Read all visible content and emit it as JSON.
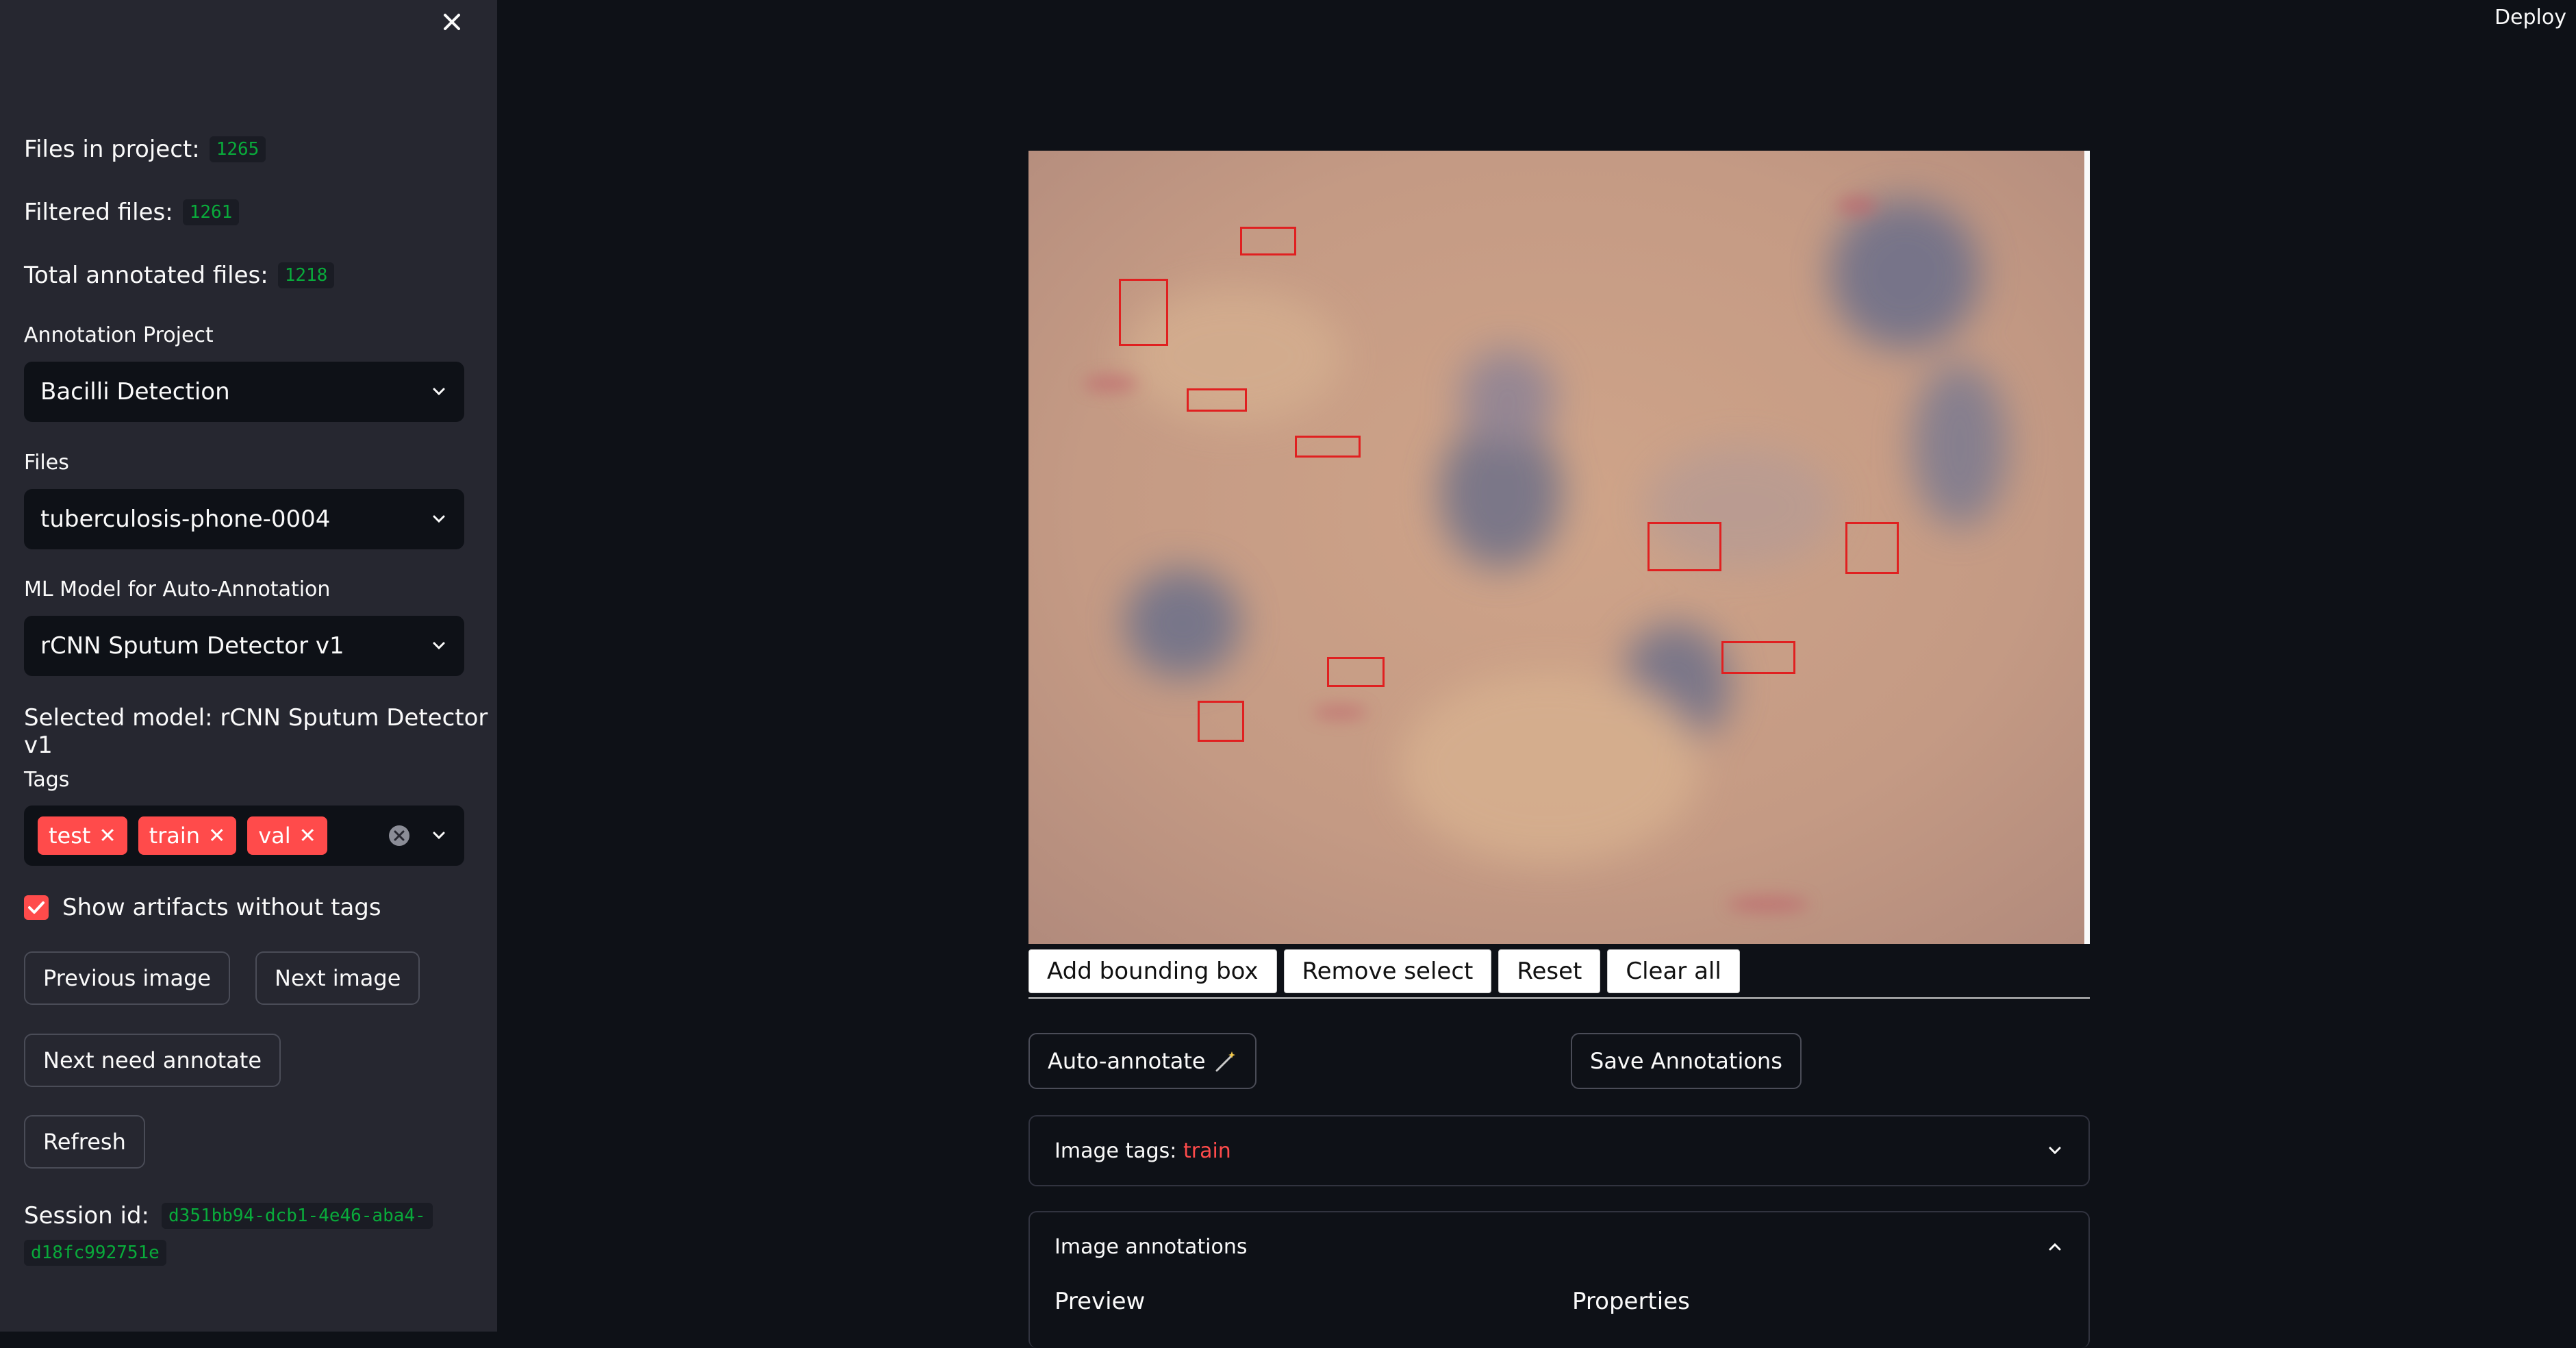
{
  "sidebar": {
    "files_in_project_label": "Files in project:",
    "files_in_project_value": "1265",
    "filtered_files_label": "Filtered files:",
    "filtered_files_value": "1261",
    "total_annotated_label": "Total annotated files:",
    "total_annotated_value": "1218",
    "project_label": "Annotation Project",
    "project_value": "Bacilli Detection",
    "files_label": "Files",
    "files_value": "tuberculosis-phone-0004",
    "model_label": "ML Model for Auto-Annotation",
    "model_value": "rCNN Sputum Detector v1",
    "selected_model_text": "Selected model: rCNN Sputum Detector v1",
    "tags_label": "Tags",
    "tags": [
      "test",
      "train",
      "val"
    ],
    "show_artifacts_label": "Show artifacts without tags",
    "show_artifacts_checked": true,
    "previous_button": "Previous image",
    "next_button": "Next image",
    "next_need_button": "Next need annotate",
    "refresh_button": "Refresh",
    "session_label": "Session id:",
    "session_part1": "d351bb94-dcb1-4e46-aba4-",
    "session_part2": "d18fc992751e"
  },
  "header": {
    "deploy": "Deploy"
  },
  "toolbar": {
    "add_bbox": "Add bounding box",
    "remove_select": "Remove select",
    "reset": "Reset",
    "clear_all": "Clear all"
  },
  "actions": {
    "auto_annotate": "Auto-annotate",
    "auto_annotate_icon": "magic-wand-icon",
    "save": "Save Annotations"
  },
  "image_tags": {
    "label": "Image tags:",
    "value": "train"
  },
  "image_annotations": {
    "title": "Image annotations",
    "preview_header": "Preview",
    "properties_header": "Properties"
  },
  "colors": {
    "accent": "#ff4b4b",
    "code_green": "#09ab3b",
    "bbox_red": "#e02020",
    "sidebar_bg": "#262730",
    "main_bg": "#0e1117"
  }
}
